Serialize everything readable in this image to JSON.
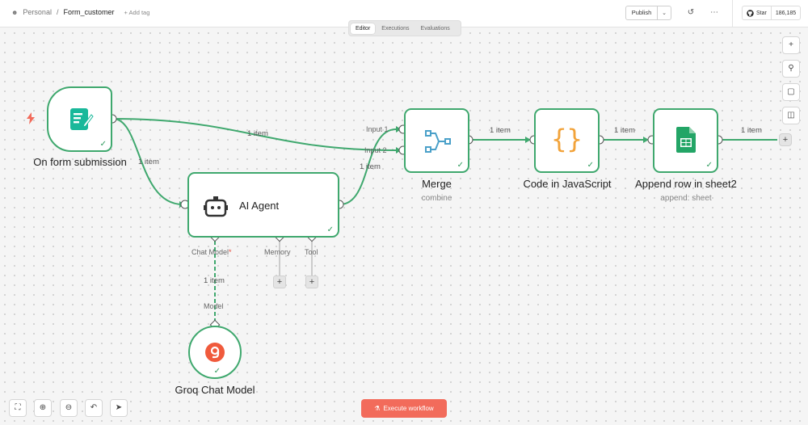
{
  "topbar": {
    "owner": "Personal",
    "separator": "/",
    "workflow_name": "Form_customer",
    "add_tag": "+ Add tag",
    "publish_label": "Publish",
    "github_star": "Star",
    "github_count": "186,185"
  },
  "tabs": [
    {
      "label": "Editor",
      "active": true
    },
    {
      "label": "Executions",
      "active": false
    },
    {
      "label": "Evaluations",
      "active": false
    }
  ],
  "nodes": {
    "form_trigger": {
      "label": "On form submission",
      "icon": "form-icon"
    },
    "ai_agent": {
      "label": "AI Agent",
      "icon": "robot-icon"
    },
    "merge": {
      "label": "Merge",
      "subtitle": "combine",
      "icon": "merge-icon"
    },
    "code": {
      "label": "Code in JavaScript",
      "icon": "braces-icon"
    },
    "sheets": {
      "label": "Append row in sheet2",
      "subtitle": "append: sheet",
      "icon": "google-sheets-icon"
    },
    "groq": {
      "label": "Groq Chat Model",
      "icon": "groq-icon"
    }
  },
  "edge_labels": {
    "form_to_merge": "1 item",
    "form_to_agent": "1 item",
    "agent_to_merge": "1 item",
    "merge_to_code": "1 item",
    "code_to_sheets": "1 item",
    "sheets_out": "1 item",
    "model_to_agent": "1 item"
  },
  "ports": {
    "merge_input1": "Input 1",
    "merge_input2": "Input 2",
    "chat_model": "Chat Model",
    "chat_model_required": "*",
    "memory": "Memory",
    "tool": "Tool",
    "model": "Model"
  },
  "execute_button": "Execute workflow",
  "colors": {
    "node_border": "#3fa86e",
    "edge": "#3fa86e",
    "trigger_icon": "#f26b5b",
    "execute_bg": "#f26b5b",
    "form_icon_bg": "#19b89a",
    "code_icon": "#f2a33a",
    "sheets_icon": "#23a566",
    "groq_icon": "#f05a3c"
  }
}
